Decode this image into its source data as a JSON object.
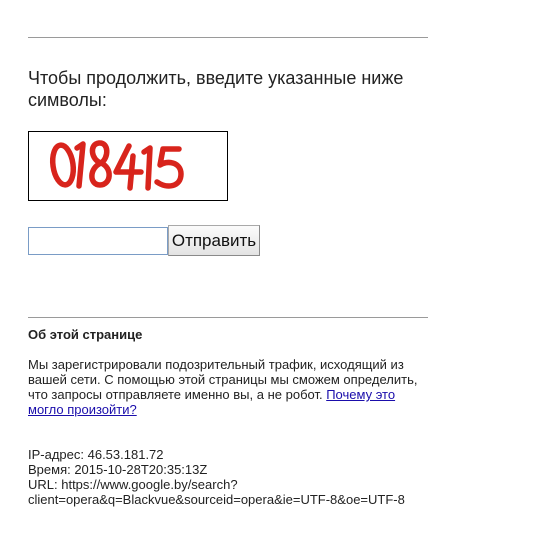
{
  "prompt": {
    "line1": "Чтобы продолжить, введите указанные ниже",
    "line2": "символы:"
  },
  "captcha": {
    "text": "018415",
    "color": "#d8241c"
  },
  "form": {
    "input_value": "",
    "submit_label": "Отправить"
  },
  "about": {
    "title": "Об этой странице",
    "text": "Мы зарегистрировали подозрительный трафик, исходящий из вашей сети. С помощью этой страницы мы сможем определить, что запросы отправляете именно вы, а не робот. ",
    "link_label": "Почему это могло произойти?"
  },
  "info": {
    "ip": "IP-адрес: 46.53.181.72",
    "time": "Время: 2015-10-28T20:35:13Z",
    "url_line1": "URL: https://www.google.by/search?",
    "url_line2": "client=opera&q=Blackvue&sourceid=opera&ie=UTF-8&oe=UTF-8"
  }
}
